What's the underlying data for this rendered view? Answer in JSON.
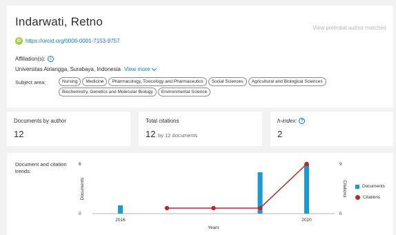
{
  "author": {
    "name": "Indarwati, Retno",
    "view_potential_label": "View potential author matches",
    "orcid_icon_text": "iD",
    "orcid_url": "https://orcid.org/0000-0001-7153-9757"
  },
  "affiliation": {
    "label": "Affiliation(s):",
    "info_icon": "i",
    "value": "Universitas Airlangga, Surabaya, Indonesia",
    "view_more_label": "View more"
  },
  "subject_area": {
    "label": "Subject area:",
    "pills": [
      "Nursing",
      "Medicine",
      "Pharmacology, Toxicology and Pharmaceutics",
      "Social Sciences",
      "Agricultural and Biological Sciences",
      "Biochemistry, Genetics and Molecular Biology",
      "Environmental Science"
    ]
  },
  "metrics": {
    "documents": {
      "label": "Documents by author",
      "value": "12"
    },
    "citations": {
      "label": "Total citations",
      "value": "12",
      "sub": "by 12 documents"
    },
    "hindex": {
      "label": "h-index:",
      "help_icon": "?",
      "value": "2"
    }
  },
  "trend": {
    "label": "Document and citation trends:"
  },
  "chart_data": {
    "type": "bar",
    "x": [
      2016,
      2017,
      2018,
      2019,
      2020
    ],
    "x_tick_labels": [
      "2016",
      "2020"
    ],
    "xlabel": "Years",
    "series": [
      {
        "name": "Documents",
        "type": "bar",
        "axis": "left",
        "color": "#1a9ad6",
        "values": [
          1,
          0,
          0,
          5,
          6
        ]
      },
      {
        "name": "Citations",
        "type": "line",
        "axis": "right",
        "color": "#b52a2a",
        "values": [
          null,
          1,
          1,
          1,
          9
        ]
      }
    ],
    "ylabel": "Documents",
    "ylim": [
      0,
      6
    ],
    "y_ticks": [
      "0",
      "6"
    ],
    "y2label": "Citations",
    "y2lim": [
      0,
      9
    ],
    "y2_ticks": [
      "0",
      "9"
    ],
    "legend_position": "right"
  }
}
